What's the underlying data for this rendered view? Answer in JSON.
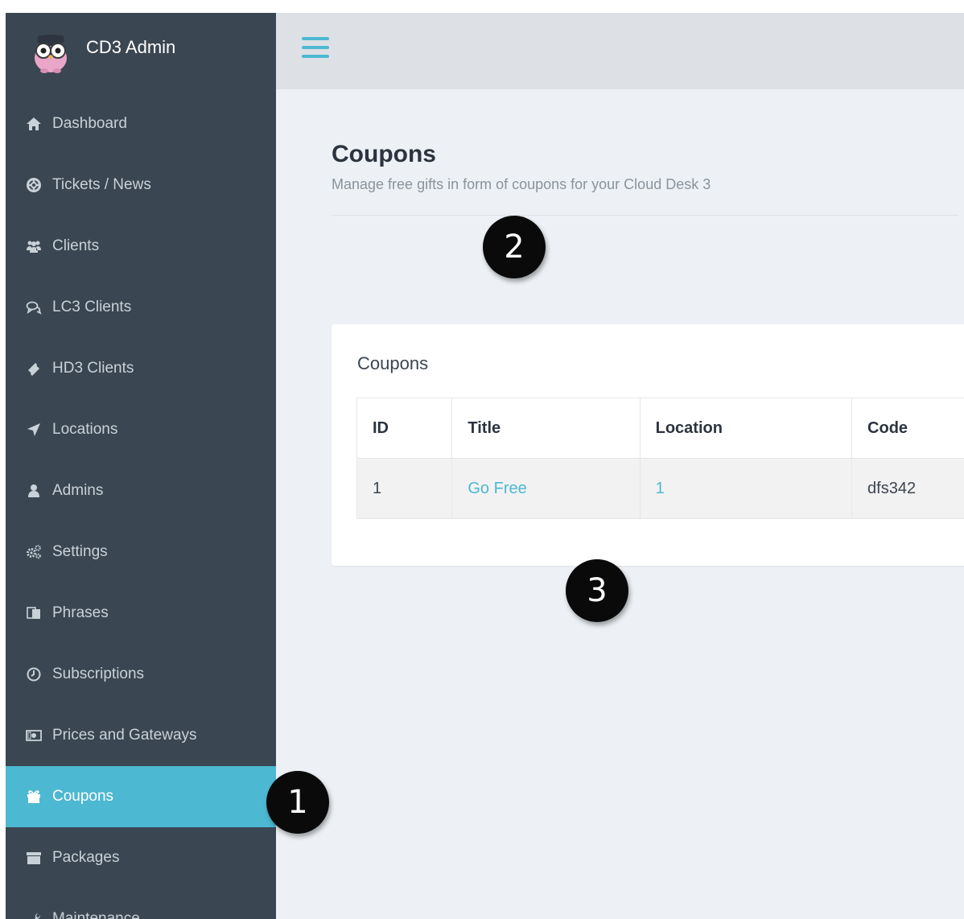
{
  "brand": {
    "title": "CD3 Admin",
    "logo_icon": "owl-logo-icon"
  },
  "sidebar": {
    "items": [
      {
        "label": "Dashboard",
        "icon": "home-icon"
      },
      {
        "label": "Tickets / News",
        "icon": "lifebuoy-icon"
      },
      {
        "label": "Clients",
        "icon": "users-icon"
      },
      {
        "label": "LC3 Clients",
        "icon": "chat-icon"
      },
      {
        "label": "HD3 Clients",
        "icon": "ticket-icon"
      },
      {
        "label": "Locations",
        "icon": "location-arrow-icon"
      },
      {
        "label": "Admins",
        "icon": "user-icon"
      },
      {
        "label": "Settings",
        "icon": "cogs-icon"
      },
      {
        "label": "Phrases",
        "icon": "phrases-icon"
      },
      {
        "label": "Subscriptions",
        "icon": "clock-icon"
      },
      {
        "label": "Prices and Gateways",
        "icon": "money-icon"
      },
      {
        "label": "Coupons",
        "icon": "gift-icon",
        "active": true
      },
      {
        "label": "Packages",
        "icon": "archive-icon"
      },
      {
        "label": "Maintenance",
        "icon": "wrench-icon"
      }
    ]
  },
  "topbar": {
    "menu_icon": "hamburger-icon"
  },
  "page": {
    "title": "Coupons",
    "subtitle": "Manage free gifts in form of coupons for your Cloud Desk 3"
  },
  "panel": {
    "title": "Coupons",
    "table": {
      "headers": [
        "ID",
        "Title",
        "Location",
        "Code"
      ],
      "rows": [
        {
          "id": "1",
          "title": "Go Free",
          "location": "1",
          "code": "dfs342"
        }
      ]
    }
  },
  "callouts": [
    "1",
    "2",
    "3"
  ],
  "colors": {
    "sidebar_bg": "#3a4651",
    "accent": "#4db8d2",
    "topbar_bg": "#dde1e6",
    "content_bg": "#edf1f5"
  }
}
